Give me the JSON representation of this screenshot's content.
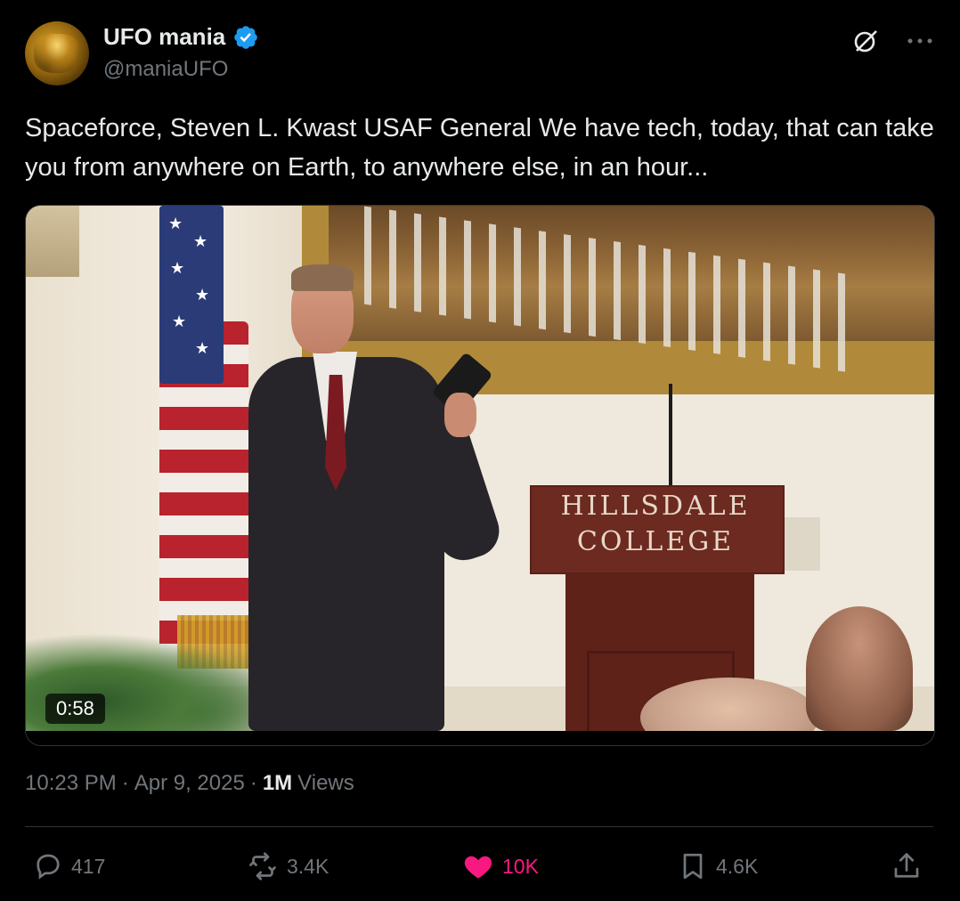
{
  "author": {
    "name": "UFO mania",
    "handle": "@maniaUFO",
    "verified_color": "#1d9bf0"
  },
  "header_icons": [
    "grok-icon",
    "more-icon"
  ],
  "tweet": {
    "text": "Spaceforce, Steven L. Kwast USAF General We have tech, today, that can take you from anywhere on Earth, to anywhere else, in an hour..."
  },
  "media": {
    "type": "video",
    "duration": "0:58",
    "podium_line1": "HILLSDALE",
    "podium_line2": "COLLEGE"
  },
  "meta": {
    "time": "10:23 PM",
    "date": "Apr 9, 2025",
    "views_count": "1M",
    "views_label": "Views",
    "separator": "·"
  },
  "actions": {
    "replies": "417",
    "reposts": "3.4K",
    "likes": "10K",
    "bookmarks": "4.6K"
  },
  "colors": {
    "background": "#000000",
    "text": "#e7e9ea",
    "muted": "#71767b",
    "like": "#f91880"
  }
}
